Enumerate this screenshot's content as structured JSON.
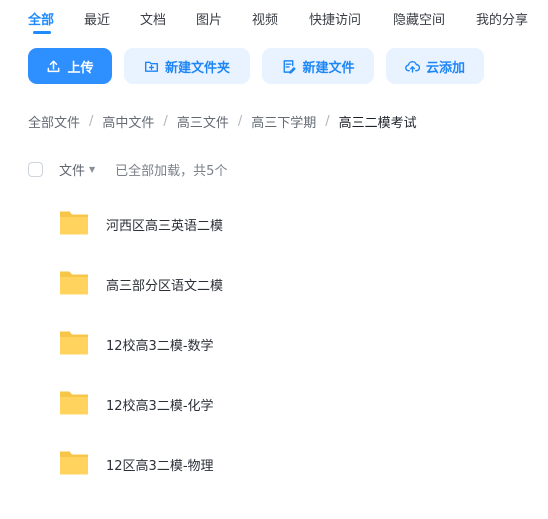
{
  "tabs": [
    {
      "label": "全部"
    },
    {
      "label": "最近"
    },
    {
      "label": "文档"
    },
    {
      "label": "图片"
    },
    {
      "label": "视频"
    },
    {
      "label": "快捷访问"
    },
    {
      "label": "隐藏空间"
    },
    {
      "label": "我的分享"
    }
  ],
  "active_tab": "全部",
  "toolbar": {
    "upload_label": "上传",
    "new_folder_label": "新建文件夹",
    "new_file_label": "新建文件",
    "cloud_add_label": "云添加"
  },
  "breadcrumb": {
    "items": [
      "全部文件",
      "高中文件",
      "高三文件",
      "高三下学期",
      "高三二模考试"
    ],
    "separator": "/"
  },
  "list_header": {
    "sort_label": "文件",
    "status": "已全部加载，共5个"
  },
  "files": [
    {
      "name": "河西区高三英语二模",
      "icon": "folder-icon"
    },
    {
      "name": "高三部分区语文二模",
      "icon": "folder-icon"
    },
    {
      "name": "12校高3二模-数学",
      "icon": "folder-icon"
    },
    {
      "name": "12校高3二模-化学",
      "icon": "folder-icon"
    },
    {
      "name": "12区高3二模-物理",
      "icon": "folder-icon"
    }
  ],
  "colors": {
    "accent": "#2e8fff",
    "secondary_button_bg": "#e9f3ff",
    "folder": "#ffd35e"
  }
}
